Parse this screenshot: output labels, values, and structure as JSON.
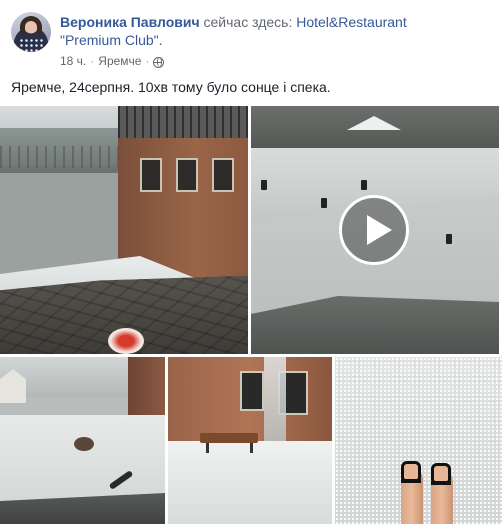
{
  "post": {
    "author": "Вероника Павлович",
    "checkin_text": "сейчас здесь:",
    "place_line1": "Hotel&Restaurant",
    "place_line2": "\"Premium Club\".",
    "time": "18 ч.",
    "location": "Яремче",
    "separator": "·",
    "privacy_icon": "globe-icon",
    "text": "Яремче, 24серпня. 10хв тому було сонце і спека."
  },
  "media": {
    "items": [
      {
        "type": "photo"
      },
      {
        "type": "video",
        "icon": "play-icon"
      },
      {
        "type": "photo"
      },
      {
        "type": "photo"
      },
      {
        "type": "photo"
      }
    ]
  },
  "colors": {
    "link": "#365899",
    "meta": "#616770",
    "text": "#1d2129"
  }
}
